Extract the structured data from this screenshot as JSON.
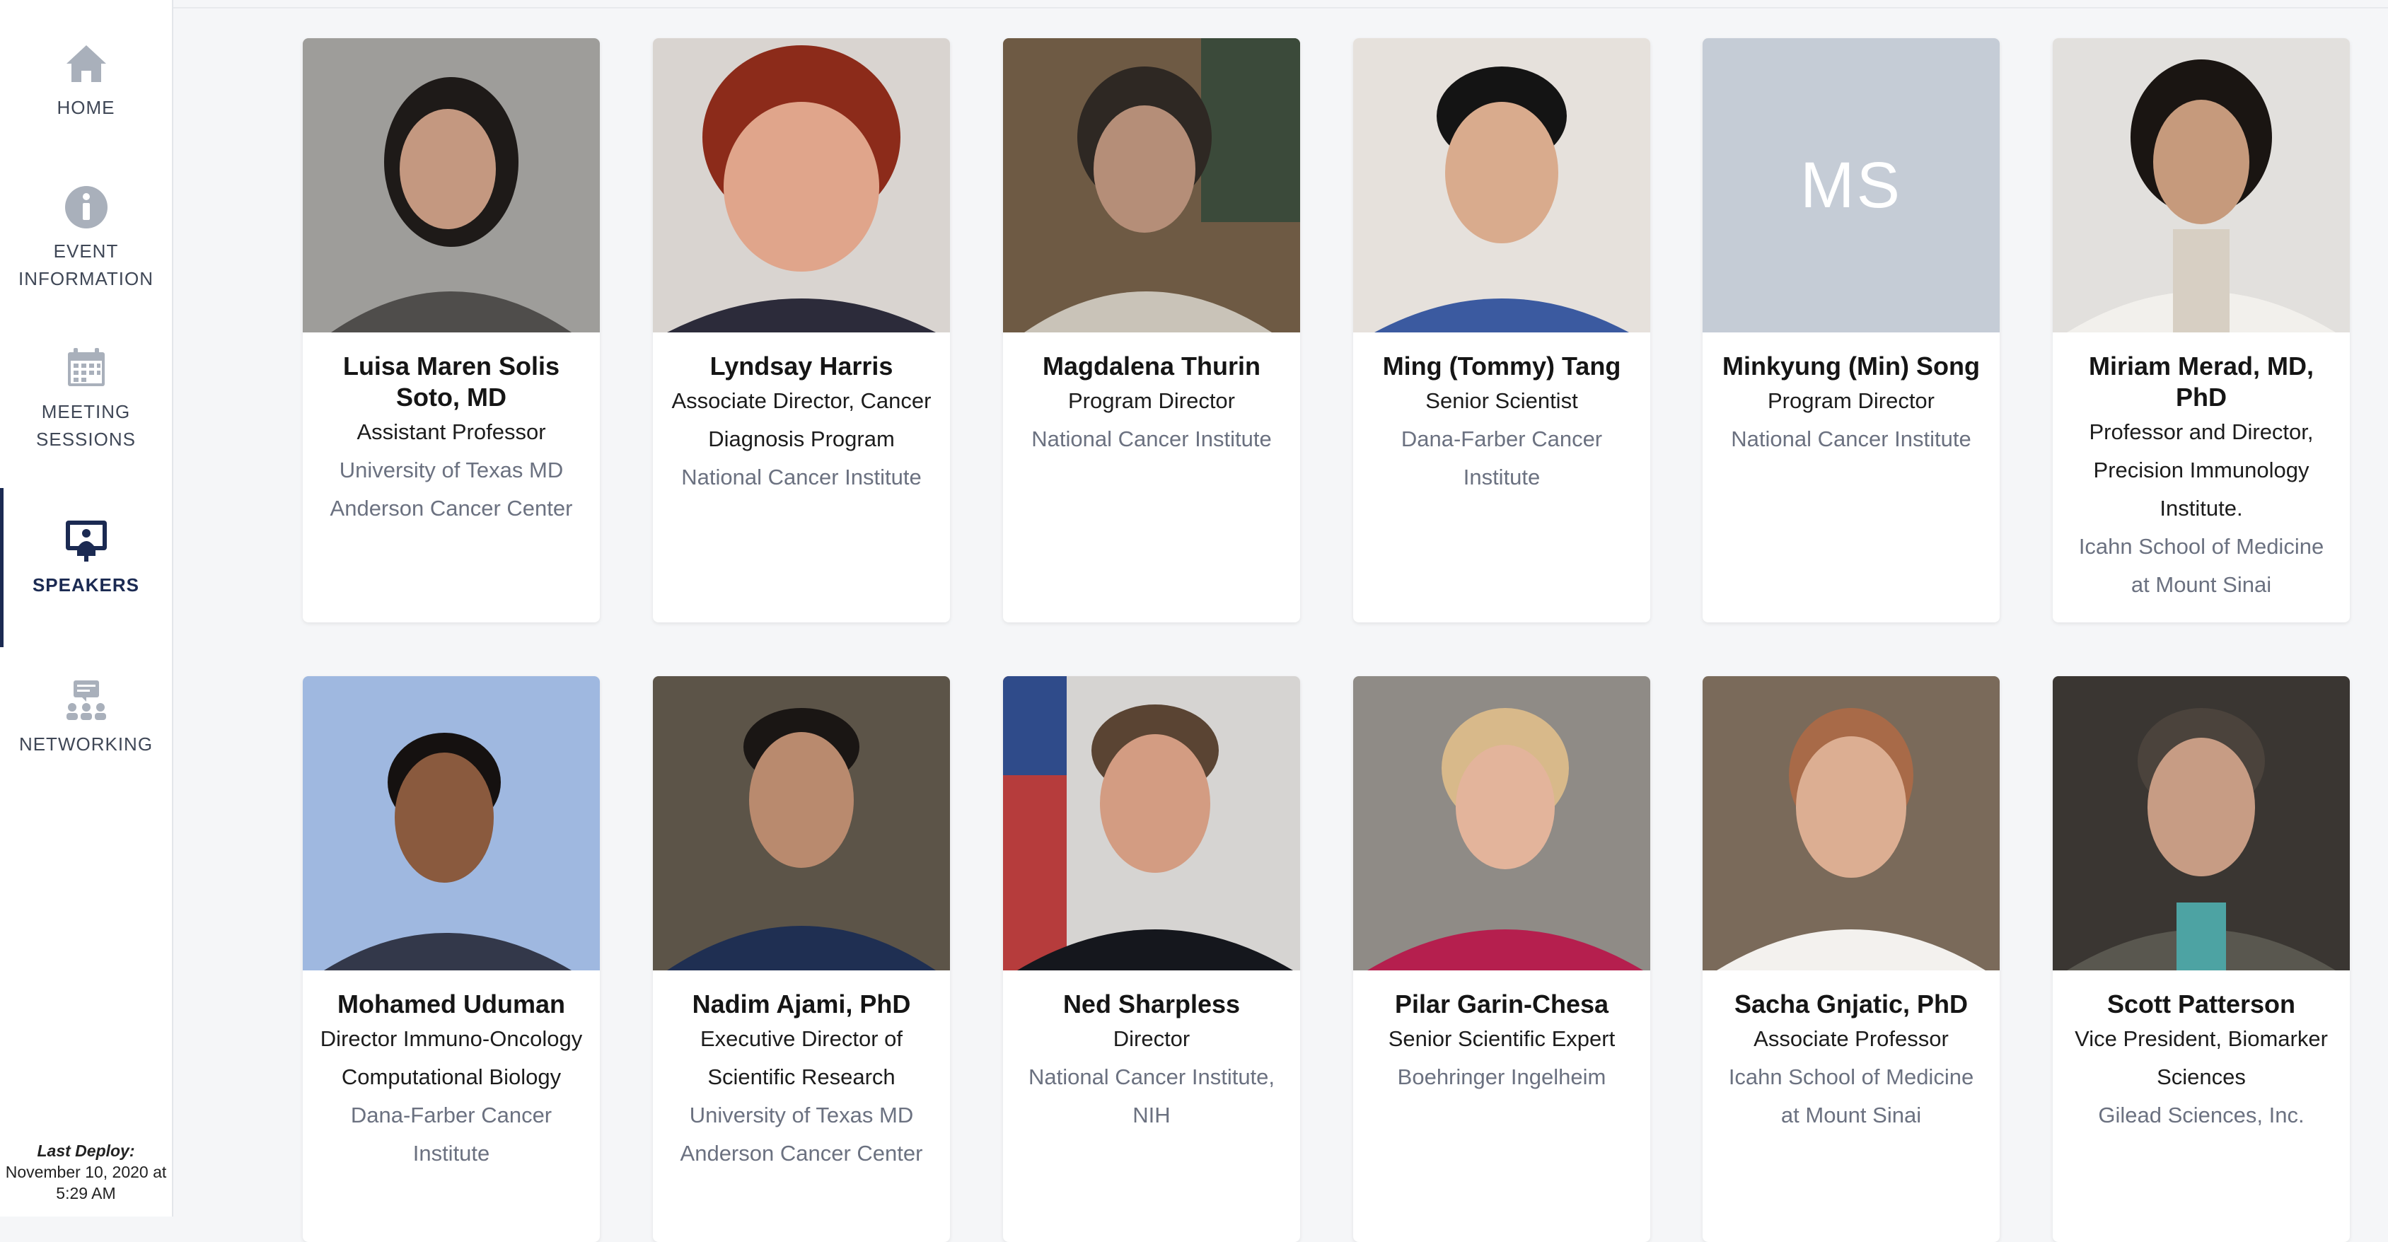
{
  "sidebar": {
    "items": [
      {
        "label": "HOME",
        "icon": "home-icon"
      },
      {
        "label_line1": "EVENT",
        "label_line2": "INFORMATION",
        "icon": "info-icon"
      },
      {
        "label_line1": "MEETING",
        "label_line2": "SESSIONS",
        "icon": "calendar-icon"
      },
      {
        "label": "SPEAKERS",
        "icon": "presenter-icon",
        "active": true
      },
      {
        "label": "NETWORKING",
        "icon": "networking-icon"
      }
    ],
    "deploy": {
      "title": "Last Deploy:",
      "line1": "November 10, 2020 at",
      "line2": "5:29 AM"
    }
  },
  "colors": {
    "accent": "#1b2a52",
    "muted": "#6b7180",
    "placeholder": "#c5ccd6"
  },
  "speakers": [
    {
      "name": "Luisa Maren Solis Soto, MD",
      "title": "Assistant Professor",
      "org": "University of Texas MD Anderson Cancer Center"
    },
    {
      "name": "Lyndsay Harris",
      "title": "Associate Director, Cancer Diagnosis Program",
      "org": "National Cancer Institute"
    },
    {
      "name": "Magdalena Thurin",
      "title": "Program Director",
      "org": "National Cancer Institute"
    },
    {
      "name": "Ming (Tommy) Tang",
      "title": "Senior Scientist",
      "org": "Dana-Farber Cancer Institute"
    },
    {
      "name": "Minkyung (Min) Song",
      "title": "Program Director",
      "org": "National Cancer Institute",
      "initials": "MS"
    },
    {
      "name": "Miriam Merad, MD, PhD",
      "title": "Professor and Director, Precision Immunology Institute.",
      "org": "Icahn School of Medicine at Mount Sinai"
    },
    {
      "name": "Mohamed Uduman",
      "title": "Director Immuno-Oncology Computational Biology",
      "org": "Dana-Farber Cancer Institute"
    },
    {
      "name": "Nadim Ajami, PhD",
      "title": "Executive Director of Scientific Research",
      "org": "University of Texas MD Anderson Cancer Center"
    },
    {
      "name": "Ned Sharpless",
      "title": "Director",
      "org": "National Cancer Institute, NIH"
    },
    {
      "name": "Pilar Garin-Chesa",
      "title": "Senior Scientific Expert",
      "org": "Boehringer Ingelheim"
    },
    {
      "name": "Sacha Gnjatic, PhD",
      "title": "Associate Professor",
      "org": "Icahn School of Medicine at Mount Sinai"
    },
    {
      "name": "Scott Patterson",
      "title": "Vice President, Biomarker Sciences",
      "org": "Gilead Sciences, Inc."
    }
  ]
}
